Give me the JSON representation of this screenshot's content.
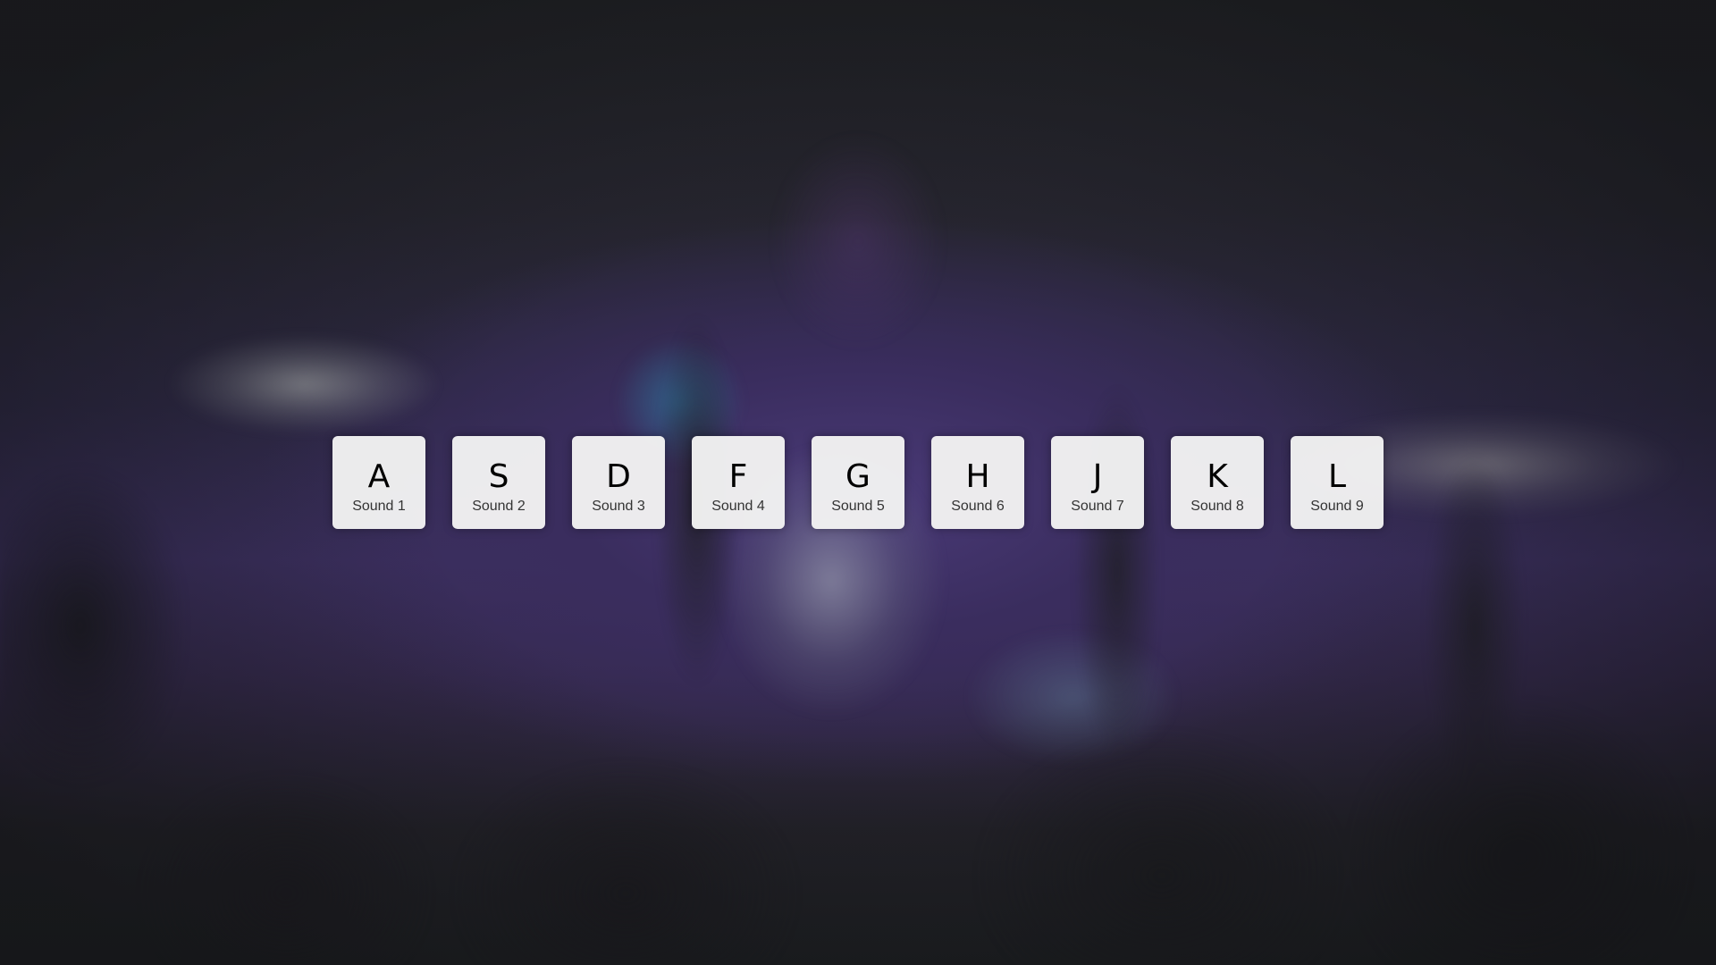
{
  "background": {
    "description_colors": {
      "base": "#1f2125",
      "purple_glow": "#4a3a78"
    }
  },
  "keys": [
    {
      "letter": "A",
      "sound": "Sound 1"
    },
    {
      "letter": "S",
      "sound": "Sound 2"
    },
    {
      "letter": "D",
      "sound": "Sound 3"
    },
    {
      "letter": "F",
      "sound": "Sound 4"
    },
    {
      "letter": "G",
      "sound": "Sound 5"
    },
    {
      "letter": "H",
      "sound": "Sound 6"
    },
    {
      "letter": "J",
      "sound": "Sound 7"
    },
    {
      "letter": "K",
      "sound": "Sound 8"
    },
    {
      "letter": "L",
      "sound": "Sound 9"
    }
  ]
}
